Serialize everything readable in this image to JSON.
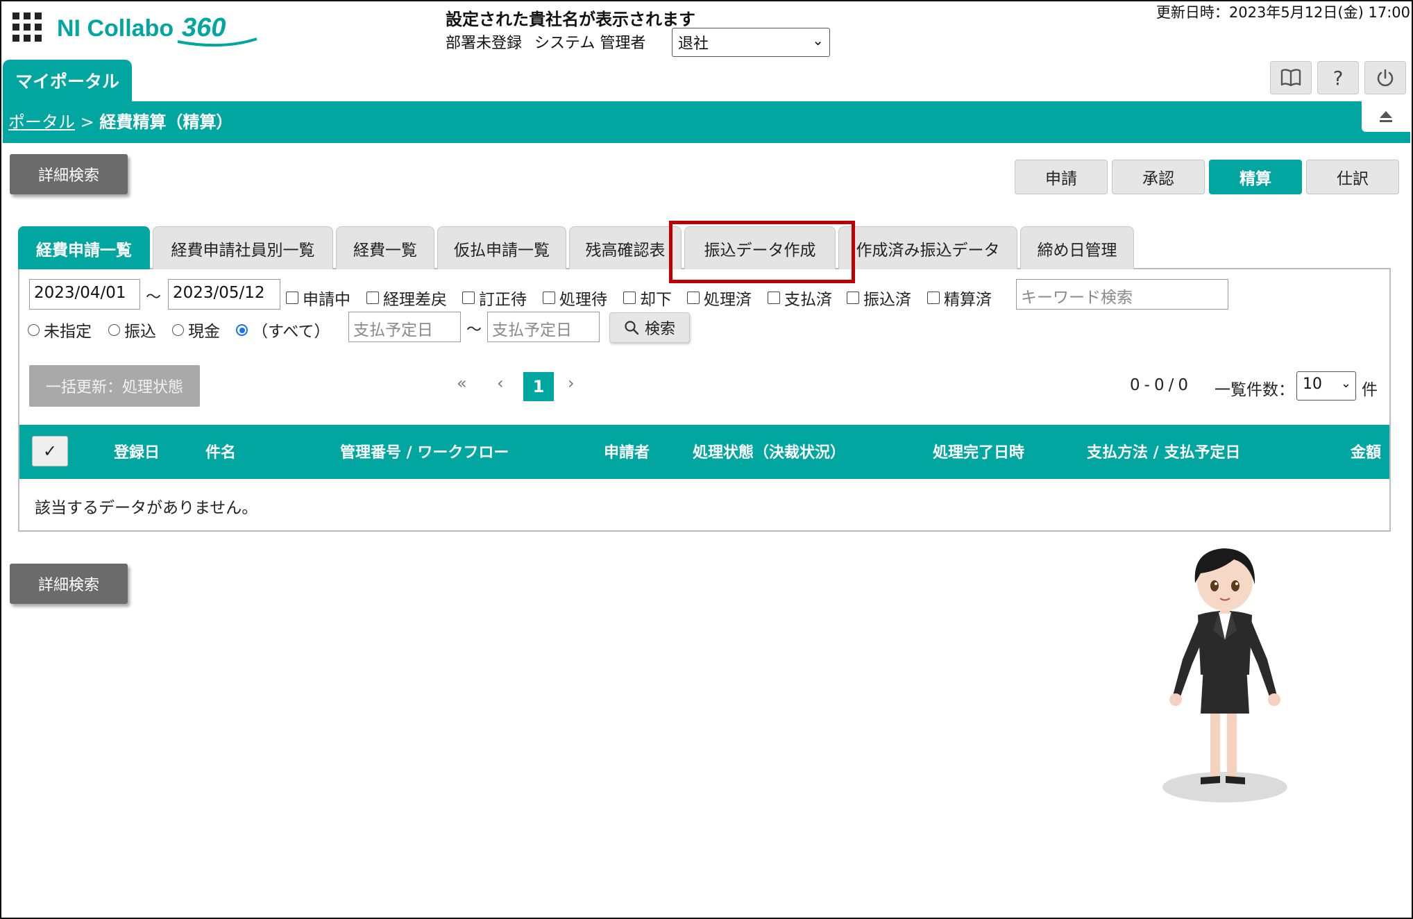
{
  "header": {
    "logo_text": "NI Collabo",
    "logo_number": "360",
    "company_name": "設定された貴社名が表示されます",
    "department": "部署未登録",
    "user_name": "システム 管理者",
    "status_select": "退社",
    "updated": "更新日時：2023年5月12日(金) 17:00"
  },
  "nav": {
    "portal_tab": "マイポータル",
    "breadcrumb_link": "ポータル",
    "breadcrumb_sep": " > ",
    "breadcrumb_current": "経費精算（精算）",
    "icons": [
      "book-icon",
      "help-icon",
      "power-icon",
      "collapse-icon"
    ]
  },
  "toolbar": {
    "detail_search": "詳細検索",
    "modes": [
      {
        "label": "申請",
        "active": false
      },
      {
        "label": "承認",
        "active": false
      },
      {
        "label": "精算",
        "active": true
      },
      {
        "label": "仕訳",
        "active": false
      }
    ]
  },
  "tabs": [
    {
      "label": "経費申請一覧",
      "active": true
    },
    {
      "label": "経費申請社員別一覧",
      "active": false
    },
    {
      "label": "経費一覧",
      "active": false
    },
    {
      "label": "仮払申請一覧",
      "active": false
    },
    {
      "label": "残高確認表",
      "active": false
    },
    {
      "label": "振込データ作成",
      "active": false,
      "highlighted": true
    },
    {
      "label": "作成済み振込データ",
      "active": false
    },
    {
      "label": "締め日管理",
      "active": false
    }
  ],
  "filters": {
    "date_from": "2023/04/01",
    "date_to": "2023/05/12",
    "tilde": "～",
    "statuses": [
      "申請中",
      "経理差戻",
      "訂正待",
      "処理待",
      "却下",
      "処理済",
      "支払済",
      "振込済",
      "精算済"
    ],
    "keyword_placeholder": "キーワード検索",
    "payment_methods": [
      {
        "label": "未指定",
        "checked": false
      },
      {
        "label": "振込",
        "checked": false
      },
      {
        "label": "現金",
        "checked": false
      },
      {
        "label": "（すべて）",
        "checked": true
      }
    ],
    "pay_date_placeholder": "支払予定日",
    "search_button": "検索"
  },
  "list": {
    "bulk_update": "一括更新：処理状態",
    "pager": {
      "first": "«",
      "prev": "‹",
      "current": "1",
      "next": "›"
    },
    "count_start": "0",
    "count_end": "0",
    "count_total": "0",
    "per_page_label": "一覧件数：",
    "per_page": "10",
    "per_page_unit": "件"
  },
  "table": {
    "check_all": "✓",
    "columns": [
      "登録日",
      "件名",
      "管理番号 / ワークフロー",
      "申請者",
      "処理状態（決裁状況）",
      "処理完了日時",
      "支払方法 / 支払予定日",
      "金額"
    ],
    "rows": [],
    "empty_message": "該当するデータがありません。"
  },
  "colors": {
    "accent": "#02a6a0",
    "highlight": "#c00000",
    "detail_button": "#6b6b6b"
  }
}
